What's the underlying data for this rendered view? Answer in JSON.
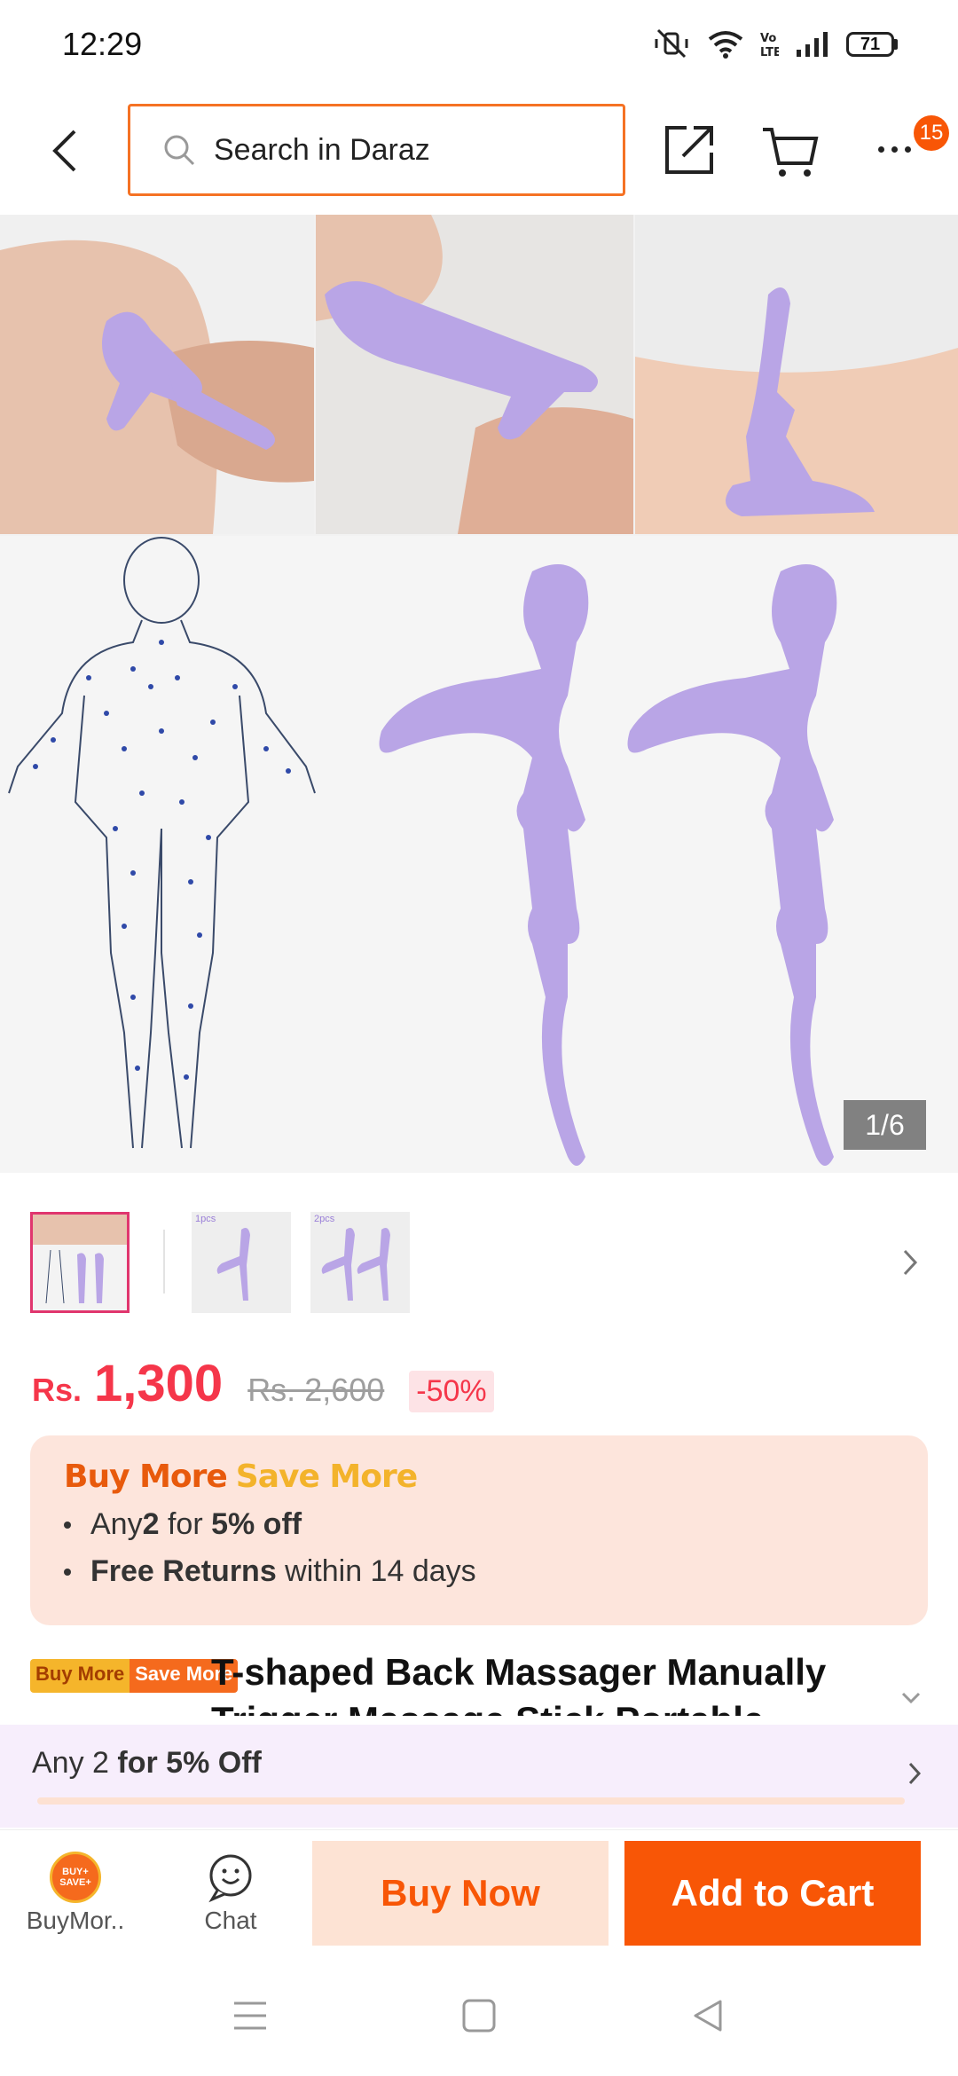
{
  "status_bar": {
    "time": "12:29",
    "battery": "71"
  },
  "header": {
    "search_placeholder": "Search in Daraz",
    "cart_badge": "15"
  },
  "gallery": {
    "page_indicator": "1/6"
  },
  "thumbnails": [
    {
      "caption": ""
    },
    {
      "caption": "1pcs"
    },
    {
      "caption": "2pcs"
    }
  ],
  "price": {
    "currency": "Rs.",
    "current": "1,300",
    "original": "Rs. 2,600",
    "discount": "-50%"
  },
  "promo": {
    "title_part1": "Buy More",
    "title_part2": "Save More",
    "line1_prefix": "Any ",
    "line1_qty": "2",
    "line1_mid": " for ",
    "line1_offer": "5% off",
    "line2_bold": "Free Returns",
    "line2_rest": " within 14 days"
  },
  "product": {
    "badge_part1": "Buy More",
    "badge_part2": "Save More",
    "title": "T-shaped Back Massager Manually Trigger Massage Stick Portable Acupoint Pre"
  },
  "bundle": {
    "prefix": "Any 2 ",
    "offer": "for 5% Off"
  },
  "actions": {
    "buymore_label": "BuyMor..",
    "buymore_icon_text": "BUY+ SAVE+",
    "chat_label": "Chat",
    "buy_now": "Buy Now",
    "add_to_cart": "Add to Cart"
  },
  "colors": {
    "accent": "#f85606",
    "price": "#f5364a",
    "search_border": "#f57224",
    "product_purple": "#b9a5e6"
  }
}
